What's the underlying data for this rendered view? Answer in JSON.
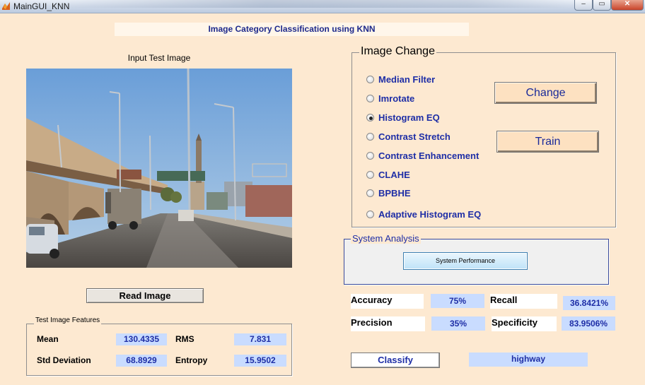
{
  "window": {
    "title": "MainGUI_KNN",
    "minimize_glyph": "‒",
    "maximize_glyph": "▭",
    "close_glyph": "✕"
  },
  "header": {
    "title": "Image Category Classification using KNN"
  },
  "input": {
    "caption": "Input Test Image",
    "read_button": "Read Image"
  },
  "features": {
    "legend": "Test Image Features",
    "mean_label": "Mean",
    "mean_value": "130.4335",
    "rms_label": "RMS",
    "rms_value": "7.831",
    "std_label": "Std Deviation",
    "std_value": "68.8929",
    "entropy_label": "Entropy",
    "entropy_value": "15.9502"
  },
  "image_change": {
    "legend": "Image Change",
    "options": [
      {
        "label": "Median Filter",
        "selected": false
      },
      {
        "label": "Imrotate",
        "selected": false
      },
      {
        "label": "Histogram EQ",
        "selected": true
      },
      {
        "label": "Contrast Stretch",
        "selected": false
      },
      {
        "label": "Contrast Enhancement",
        "selected": false
      },
      {
        "label": "CLAHE",
        "selected": false
      },
      {
        "label": "BPBHE",
        "selected": false
      },
      {
        "label": "Adaptive Histogram EQ",
        "selected": false
      }
    ],
    "change_button": "Change",
    "train_button": "Train"
  },
  "analysis": {
    "legend": "System Analysis",
    "performance_button": "System Performance"
  },
  "metrics": {
    "accuracy_label": "Accuracy",
    "accuracy_value": "75%",
    "recall_label": "Recall",
    "recall_value": "36.8421%",
    "precision_label": "Precision",
    "precision_value": "35%",
    "specificity_label": "Specificity",
    "specificity_value": "83.9506%"
  },
  "classify": {
    "button": "Classify",
    "result": "highway"
  }
}
